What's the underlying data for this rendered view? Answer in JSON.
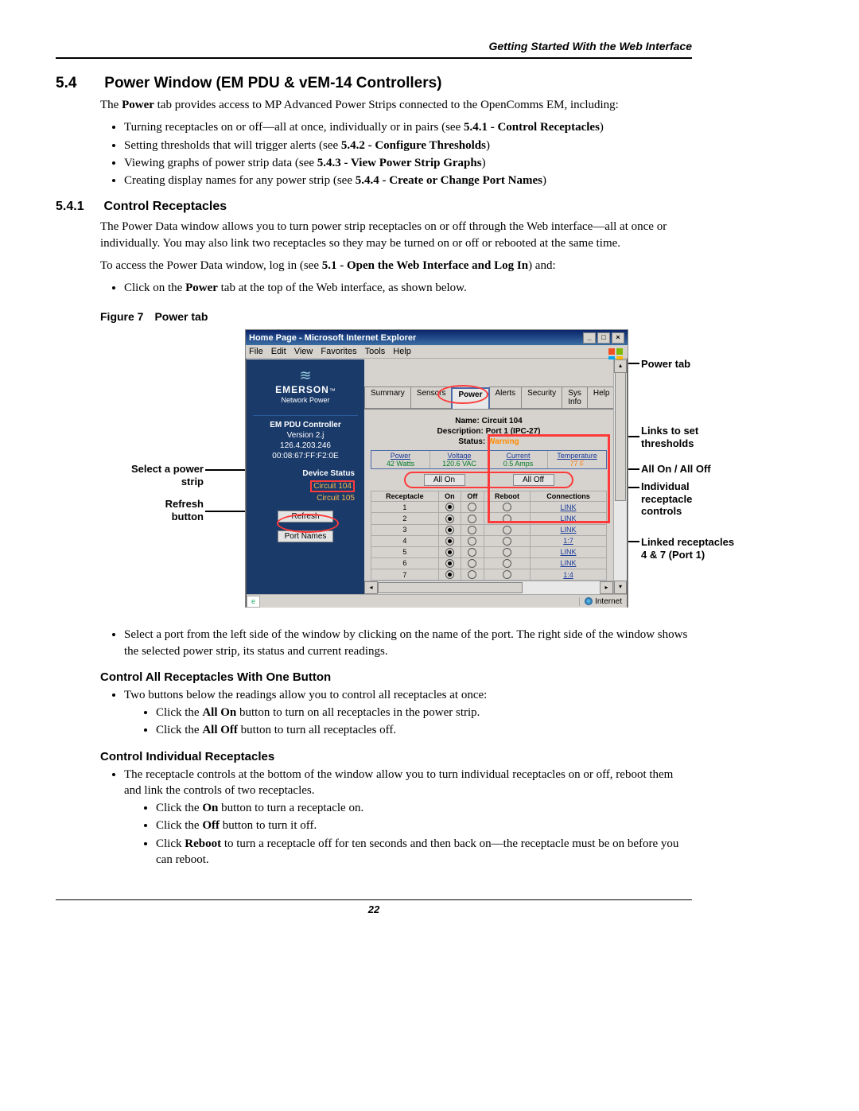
{
  "header": {
    "running_head": "Getting Started With the Web Interface"
  },
  "section": {
    "num": "5.4",
    "title": "Power Window (EM PDU & vEM-14 Controllers)",
    "intro_prefix": "The ",
    "intro_bold": "Power",
    "intro_suffix": " tab provides access to MP Advanced Power Strips connected to the OpenComms EM, including:",
    "bullets": {
      "b1_pre": "Turning receptacles on or off—all at once, individually or in pairs (see ",
      "b1_bold": "5.4.1 - Control Receptacles",
      "b1_post": ")",
      "b2_pre": "Setting thresholds that will trigger alerts (see ",
      "b2_bold": "5.4.2 - Configure Thresholds",
      "b2_post": ")",
      "b3_pre": "Viewing graphs of power strip data (see ",
      "b3_bold": "5.4.3 - View Power Strip Graphs",
      "b3_post": ")",
      "b4_pre": "Creating display names for any power strip (see ",
      "b4_bold": "5.4.4 - Create or Change Port Names",
      "b4_post": ")"
    }
  },
  "sub": {
    "num": "5.4.1",
    "title": "Control Receptacles",
    "p1": "The Power Data window allows you to turn power strip receptacles on or off through the Web interface—all at once or individually. You may also link two receptacles so they may be turned on or off or rebooted at the same time.",
    "p2_pre": "To access the Power Data window, log in (see ",
    "p2_bold": "5.1 - Open the Web Interface and Log In",
    "p2_post": ") and:",
    "p3_pre": "Click on the ",
    "p3_bold": "Power",
    "p3_post": " tab at the top of the Web interface, as shown below."
  },
  "figure": {
    "label": "Figure 7",
    "title": "Power tab"
  },
  "annot": {
    "select_ps": "Select a power strip",
    "refresh": "Refresh button",
    "power_tab": "Power tab",
    "links": "Links to set thresholds",
    "allon": "All On / All Off",
    "indiv": "Individual receptacle controls",
    "linked": "Linked receptacles 4 & 7 (Port 1)"
  },
  "browser": {
    "title": "Home Page - Microsoft Internet Explorer",
    "menu": {
      "file": "File",
      "edit": "Edit",
      "view": "View",
      "fav": "Favorites",
      "tools": "Tools",
      "help": "Help"
    },
    "status_zone": "Internet"
  },
  "sidebar": {
    "brand": "EMERSON",
    "brand_tm": "™",
    "brand_sub": "Network Power",
    "ctrl_name": "EM PDU Controller",
    "ctrl_ver": "Version 2.j",
    "ctrl_ip": "126.4.203.246",
    "ctrl_mac": "00:08:67:FF:F2:0E",
    "dev_hdr": "Device Status",
    "dev1": "Circuit 104",
    "dev2": "Circuit 105",
    "refresh_btn": "Refresh",
    "portnames_btn": "Port Names"
  },
  "tabs": {
    "summary": "Summary",
    "sensors": "Sensors",
    "power": "Power",
    "alerts": "Alerts",
    "security": "Security",
    "sysinfo": "Sys Info",
    "help": "Help"
  },
  "info": {
    "name_lbl": "Name:",
    "name_val": "Circuit 104",
    "desc_lbl": "Description:",
    "desc_val": "Port 1 (IPC-27)",
    "status_lbl": "Status:",
    "status_val": "Warning"
  },
  "readings": {
    "power": {
      "hdr": "Power",
      "val": "42 Watts"
    },
    "voltage": {
      "hdr": "Voltage",
      "val": "120.6 VAC"
    },
    "current": {
      "hdr": "Current",
      "val": "0.5 Amps"
    },
    "temp": {
      "hdr": "Temperature",
      "val": "77 F"
    }
  },
  "allbtns": {
    "on": "All On",
    "off": "All Off"
  },
  "rtable": {
    "hdr": {
      "r": "Receptacle",
      "on": "On",
      "off": "Off",
      "reboot": "Reboot",
      "conn": "Connections"
    },
    "rows": [
      {
        "n": "1",
        "link": "LINK"
      },
      {
        "n": "2",
        "link": "LINK"
      },
      {
        "n": "3",
        "link": "LINK"
      },
      {
        "n": "4",
        "link": "1:7"
      },
      {
        "n": "5",
        "link": "LINK"
      },
      {
        "n": "6",
        "link": "LINK"
      },
      {
        "n": "7",
        "link": "1:4"
      }
    ]
  },
  "post": {
    "sel_port": "Select a port from the left side of the window by clicking on the name of the port. The right side of the window shows the selected power strip, its status and current readings."
  },
  "ctrl_all": {
    "heading": "Control All Receptacles With One Button",
    "intro": "Two buttons below the readings allow you to control all receptacles at once:",
    "on_pre": "Click the ",
    "on_bold": "All On",
    "on_post": " button to turn on all receptacles in the power strip.",
    "off_pre": "Click the ",
    "off_bold": "All Off",
    "off_post": " button to turn all receptacles off."
  },
  "ctrl_ind": {
    "heading": "Control Individual Receptacles",
    "intro": "The receptacle controls at the bottom of the window allow you to turn individual receptacles on or off, reboot them and link the controls of two receptacles.",
    "on_pre": "Click the ",
    "on_bold": "On",
    "on_post": " button to turn a receptacle on.",
    "off_pre": "Click the ",
    "off_bold": "Off",
    "off_post": " button to turn it off.",
    "rb_pre": "Click ",
    "rb_bold": "Reboot",
    "rb_post": " to turn a receptacle off for ten seconds and then back on—the receptacle must be on before you can reboot."
  },
  "page_num": "22"
}
